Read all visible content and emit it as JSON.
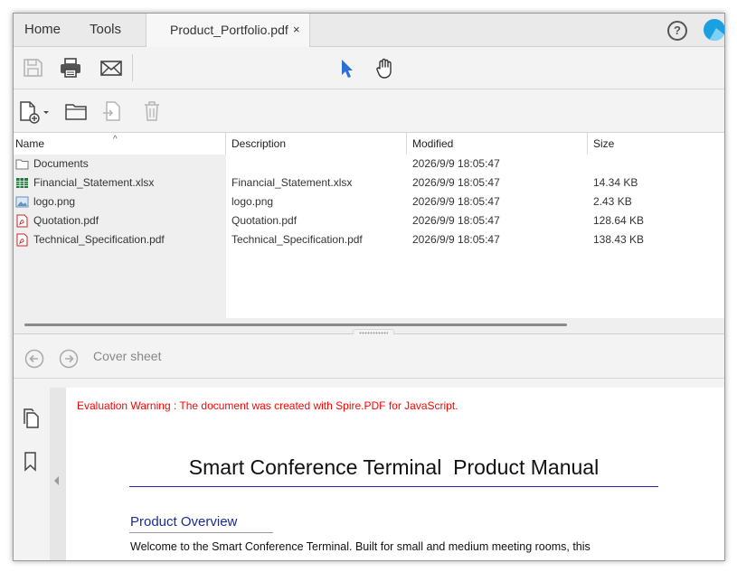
{
  "tabs": {
    "home": "Home",
    "tools": "Tools",
    "document": "Product_Portfolio.pdf",
    "close": "×"
  },
  "help": "?",
  "table": {
    "headers": {
      "name": "Name",
      "description": "Description",
      "modified": "Modified",
      "size": "Size"
    },
    "rows": [
      {
        "name": "Documents",
        "description": "",
        "modified": "2026/9/9 18:05:47",
        "size": "",
        "icon": "folder-icon"
      },
      {
        "name": "Financial_Statement.xlsx",
        "description": "Financial_Statement.xlsx",
        "modified": "2026/9/9 18:05:47",
        "size": "14.34 KB",
        "icon": "spreadsheet-icon"
      },
      {
        "name": "logo.png",
        "description": "logo.png",
        "modified": "2026/9/9 18:05:47",
        "size": "2.43 KB",
        "icon": "image-icon"
      },
      {
        "name": "Quotation.pdf",
        "description": "Quotation.pdf",
        "modified": "2026/9/9 18:05:47",
        "size": "128.64 KB",
        "icon": "pdf-icon"
      },
      {
        "name": "Technical_Specification.pdf",
        "description": "Technical_Specification.pdf",
        "modified": "2026/9/9 18:05:47",
        "size": "138.43 KB",
        "icon": "pdf-icon"
      }
    ]
  },
  "nav": {
    "cover_label": "Cover sheet"
  },
  "document": {
    "warning": "Evaluation Warning : The document was created with Spire.PDF for JavaScript.",
    "title": "Smart Conference Terminal  Product Manual",
    "section_heading": "Product Overview",
    "body_line": "Welcome to the Smart Conference Terminal. Built for small and medium meeting rooms, this"
  },
  "colors": {
    "accent": "#1ba1e2",
    "pointer": "#2a6fd6",
    "warning": "#ff0000",
    "heading": "#1a2a9a"
  }
}
